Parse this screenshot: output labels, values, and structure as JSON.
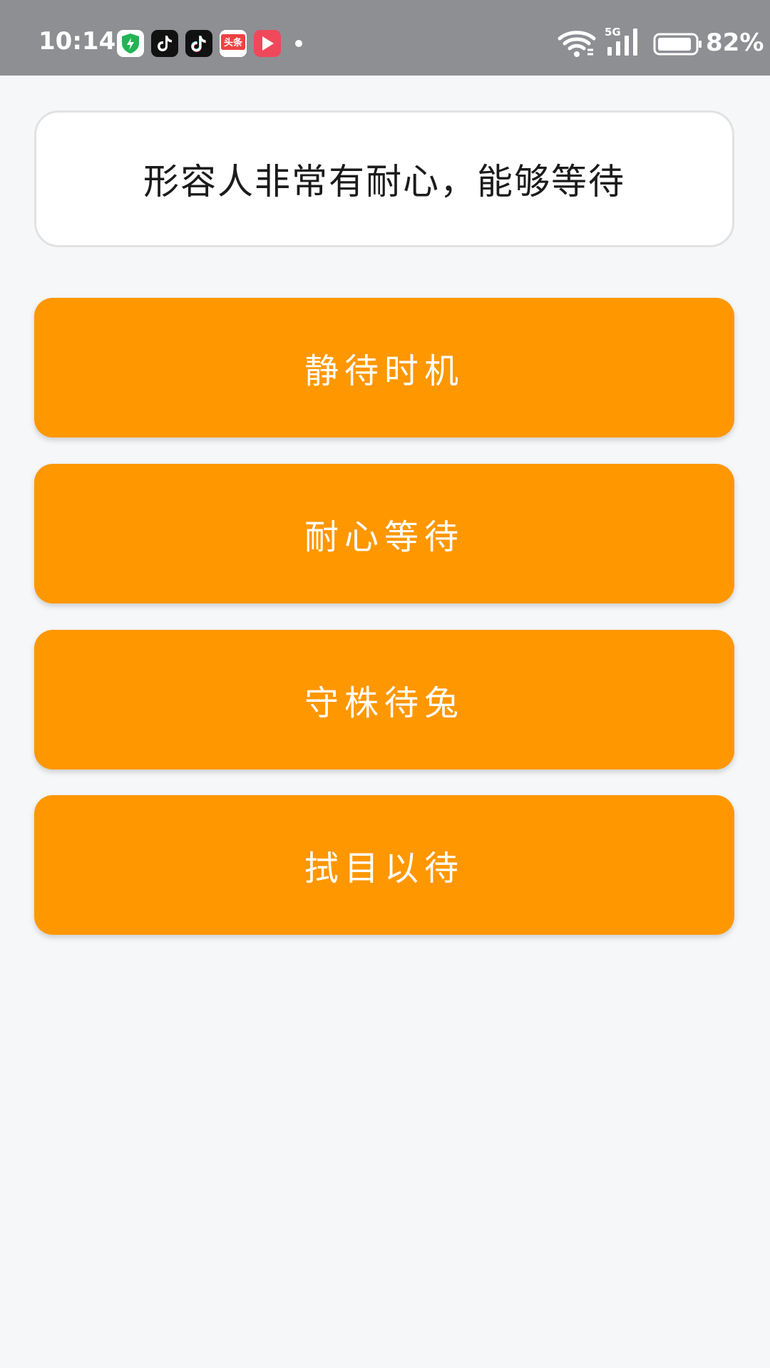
{
  "status_bar": {
    "time": "10:14",
    "battery": "82%",
    "network": "5G",
    "icons": [
      "security-shield-icon",
      "douyin-icon",
      "douyin-icon",
      "toutiao-icon",
      "video-icon",
      "notification-dot"
    ]
  },
  "question": {
    "text": "形容人非常有耐心，能够等待"
  },
  "options": [
    {
      "label": "静待时机"
    },
    {
      "label": "耐心等待"
    },
    {
      "label": "守株待兔"
    },
    {
      "label": "拭目以待"
    }
  ],
  "colors": {
    "accent": "#fe9700",
    "status_bar": "#8e8f93",
    "background": "#f6f7f9"
  },
  "toutiao_icon_text": "头条"
}
